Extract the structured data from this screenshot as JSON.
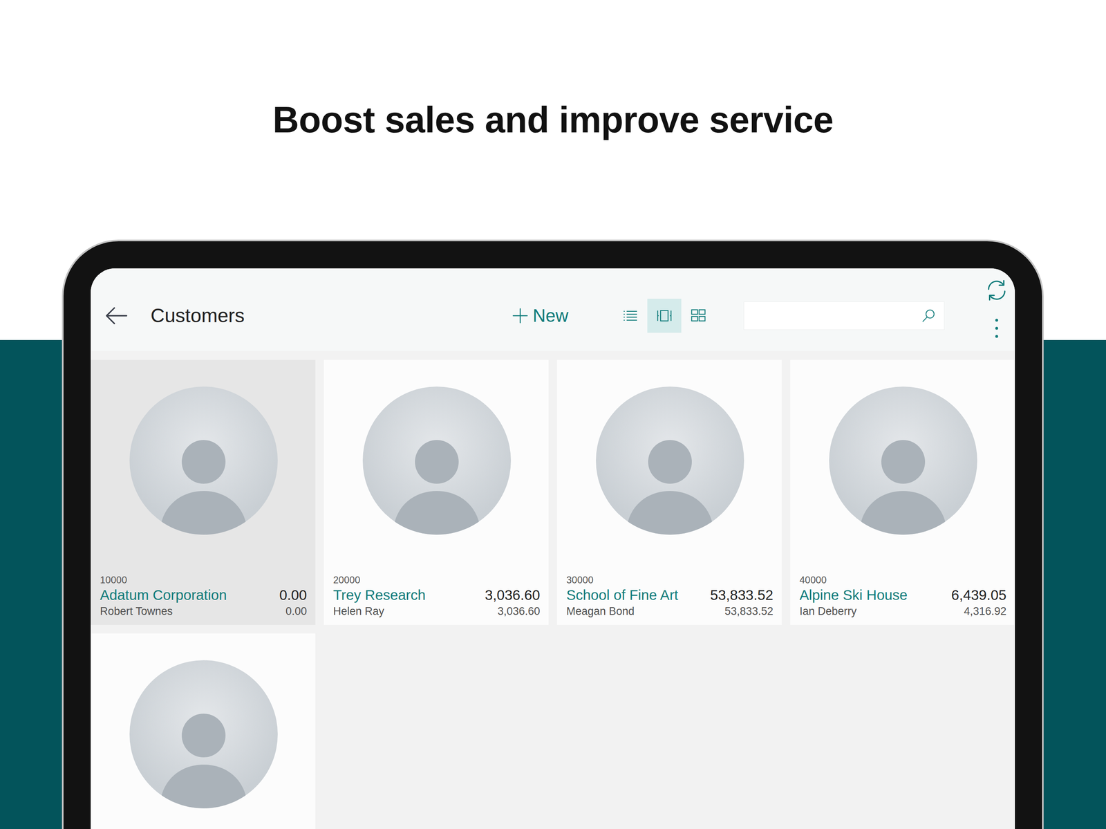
{
  "headline": "Boost sales and improve service",
  "page": {
    "title": "Customers"
  },
  "toolbar": {
    "new_label": "New",
    "views": [
      {
        "kind": "list",
        "selected": false
      },
      {
        "kind": "tile",
        "selected": true
      },
      {
        "kind": "brick",
        "selected": false
      }
    ]
  },
  "search": {
    "value": ""
  },
  "customers": [
    {
      "number": "10000",
      "name": "Adatum Corporation",
      "amount": "0.00",
      "contact": "Robert Townes",
      "sub_amount": "0.00",
      "selected": true
    },
    {
      "number": "20000",
      "name": "Trey Research",
      "amount": "3,036.60",
      "contact": "Helen Ray",
      "sub_amount": "3,036.60",
      "selected": false
    },
    {
      "number": "30000",
      "name": "School of Fine Art",
      "amount": "53,833.52",
      "contact": "Meagan Bond",
      "sub_amount": "53,833.52",
      "selected": false
    },
    {
      "number": "40000",
      "name": "Alpine Ski House",
      "amount": "6,439.05",
      "contact": "Ian Deberry",
      "sub_amount": "4,316.92",
      "selected": false
    },
    {
      "selected": false
    }
  ]
}
